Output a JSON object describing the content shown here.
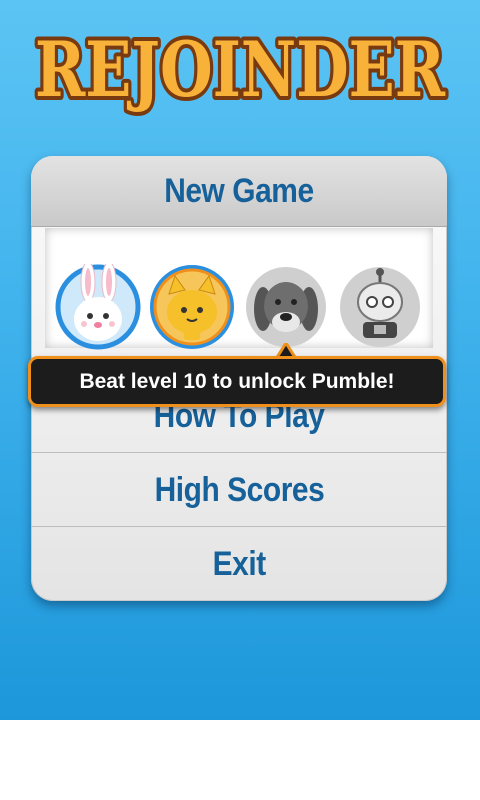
{
  "game": {
    "title": "REJOINDER"
  },
  "menu": {
    "new_game": "New Game",
    "how_to_play": "How To Play",
    "high_scores": "High Scores",
    "exit": "Exit"
  },
  "characters": [
    {
      "name": "bunny",
      "locked": false,
      "ring_color": "#2b8fe0"
    },
    {
      "name": "cat",
      "locked": false,
      "ring_color": "#f0901c"
    },
    {
      "name": "dog",
      "locked": true
    },
    {
      "name": "robot",
      "locked": true
    }
  ],
  "tooltip": {
    "text": "Beat level 10 to unlock Pumble!"
  },
  "colors": {
    "background": "#3fb2ec",
    "menu_text": "#17619a",
    "tooltip_border": "#f0901c",
    "logo_fill": "#f5a623"
  }
}
